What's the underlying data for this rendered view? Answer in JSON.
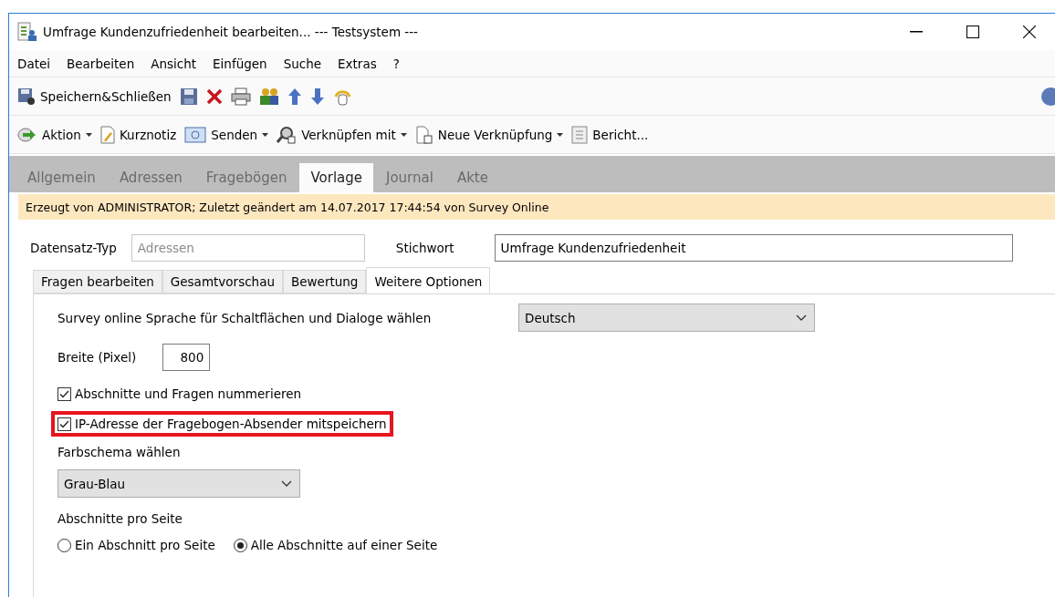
{
  "window": {
    "title": "Umfrage Kundenzufriedenheit bearbeiten... --- Testsystem ---"
  },
  "menu": [
    "Datei",
    "Bearbeiten",
    "Ansicht",
    "Einfügen",
    "Suche",
    "Extras",
    "?"
  ],
  "toolbar": {
    "save_close_label": "Speichern&Schließen"
  },
  "actions": [
    {
      "label": "Aktion",
      "dropdown": true
    },
    {
      "label": "Kurznotiz",
      "dropdown": false
    },
    {
      "label": "Senden",
      "dropdown": true
    },
    {
      "label": "Verknüpfen mit",
      "dropdown": true
    },
    {
      "label": "Neue Verknüpfung",
      "dropdown": true
    },
    {
      "label": "Bericht...",
      "dropdown": false
    }
  ],
  "tabs": [
    {
      "label": "Allgemein",
      "selected": false
    },
    {
      "label": "Adressen",
      "selected": false
    },
    {
      "label": "Fragebögen",
      "selected": false
    },
    {
      "label": "Vorlage",
      "selected": true
    },
    {
      "label": "Journal",
      "selected": false
    },
    {
      "label": "Akte",
      "selected": false
    }
  ],
  "info": "Erzeugt von ADMINISTRATOR; Zuletzt geändert am 14.07.2017 17:44:54 von Survey Online",
  "record_type": {
    "label": "Datensatz-Typ",
    "value": "Adressen",
    "disabled": true
  },
  "keyword": {
    "label": "Stichwort",
    "value": "Umfrage Kundenzufriedenheit"
  },
  "subtabs": [
    {
      "label": "Fragen bearbeiten",
      "selected": false
    },
    {
      "label": "Gesamtvorschau",
      "selected": false
    },
    {
      "label": "Bewertung",
      "selected": false
    },
    {
      "label": "Weitere Optionen",
      "selected": true
    }
  ],
  "language": {
    "label": "Survey online Sprache für Schaltflächen und Dialoge wählen",
    "value": "Deutsch"
  },
  "width": {
    "label": "Breite (Pixel)",
    "value": "800"
  },
  "checkboxes": [
    {
      "label": "Abschnitte und Fragen nummerieren",
      "checked": true,
      "highlighted": false
    },
    {
      "label": "IP-Adresse der Fragebogen-Absender mitspeichern",
      "checked": true,
      "highlighted": true
    }
  ],
  "color_scheme": {
    "label": "Farbschema wählen",
    "value": "Grau-Blau"
  },
  "sections": {
    "label": "Abschnitte pro Seite",
    "options": [
      {
        "label": "Ein Abschnitt pro Seite",
        "selected": false
      },
      {
        "label": "Alle Abschnitte auf einer Seite",
        "selected": true
      }
    ]
  }
}
